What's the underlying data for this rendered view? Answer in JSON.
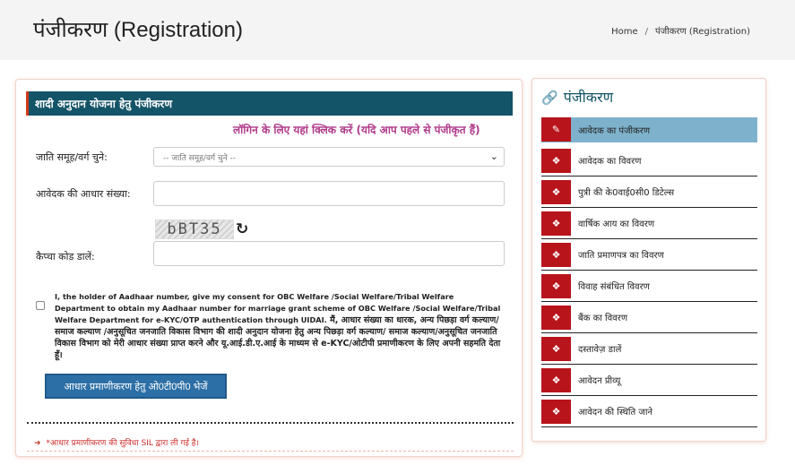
{
  "header": {
    "title": "पंजीकरण (Registration)",
    "breadcrumb": {
      "home": "Home",
      "separator": "/",
      "current": "पंजीकरण (Registration)"
    }
  },
  "form": {
    "section_title": "शादी अनुदान योजना हेतु पंजीकरण",
    "login_link": "लॉगिन के लिए यहां क्लिक करें (यदि आप पहले से पंजीकृत हैं)",
    "caste_label": "जाति समूह/वर्ग चुने:",
    "caste_placeholder": "-- जाति समूह/वर्ग चुने --",
    "aadhaar_label": "आवेदक की आधार संख्या:",
    "aadhaar_value": "",
    "captcha_text": "bBT35",
    "captcha_label": "कैप्चा कोड डालें:",
    "captcha_value": "",
    "consent_english": "I, the holder of Aadhaar number, give my consent for OBC Welfare /Social Welfare/Tribal Welfare Department to obtain my Aadhaar number for marriage grant scheme of OBC Welfare /Social Welfare/Tribal Welfare Department for e-KYC/OTP authentication through UIDAI.",
    "consent_hindi": "मैं, आधार संख्या का धारक, अन्य पिछड़ा वर्ग कल्याण/समाज कल्याण /अनुसूचित जनजाति विकास विभाग की शादी अनुदान योजना हेतु अन्य पिछड़ा वर्ग कल्याण/ समाज कल्याण/अनुसूचित जनजाति विकास विभाग को मेरी आधार संख्या प्राप्त करने और यू.आई.डी.ए.आई के माध्यम से e-KYC/ओटीपी प्रमाणीकरण के लिए अपनी सहमति देता हूँ।",
    "submit_label": "आधार प्रमाणीकरण हेतु ओ0टी0पी0 भेजें",
    "note": "*आधार प्रमाणीकरण की सुविधा SIL द्वारा ली गई है।"
  },
  "sidebar": {
    "title": "पंजीकरण",
    "items": [
      {
        "label": "आवेदक का पंजीकरण",
        "icon": "edit-icon",
        "active": true
      },
      {
        "label": "आवेदक का विवरण",
        "icon": "cube-icon"
      },
      {
        "label": "पुत्री की के0वाई0सी0 डिटेल्स",
        "icon": "cube-icon"
      },
      {
        "label": "वार्षिक आय का विवरण",
        "icon": "cube-icon"
      },
      {
        "label": "जाति प्रमाणपत्र का विवरण",
        "icon": "cube-icon"
      },
      {
        "label": "विवाह संबंधित विवरण",
        "icon": "cube-icon"
      },
      {
        "label": "बैंक का विवरण",
        "icon": "cube-icon"
      },
      {
        "label": "दस्तावेज़ डालें",
        "icon": "cube-icon"
      },
      {
        "label": "आवेदन प्रीव्यू",
        "icon": "cube-icon"
      },
      {
        "label": "आवेदन की स्थिति जाने",
        "icon": "cube-icon"
      }
    ]
  },
  "colors": {
    "section_header_bg": "#145468",
    "accent_red": "#b8141b",
    "active_menu_bg": "#7eb2cc",
    "button_blue": "#2c6fa6",
    "link_purple": "#b03a8a"
  }
}
